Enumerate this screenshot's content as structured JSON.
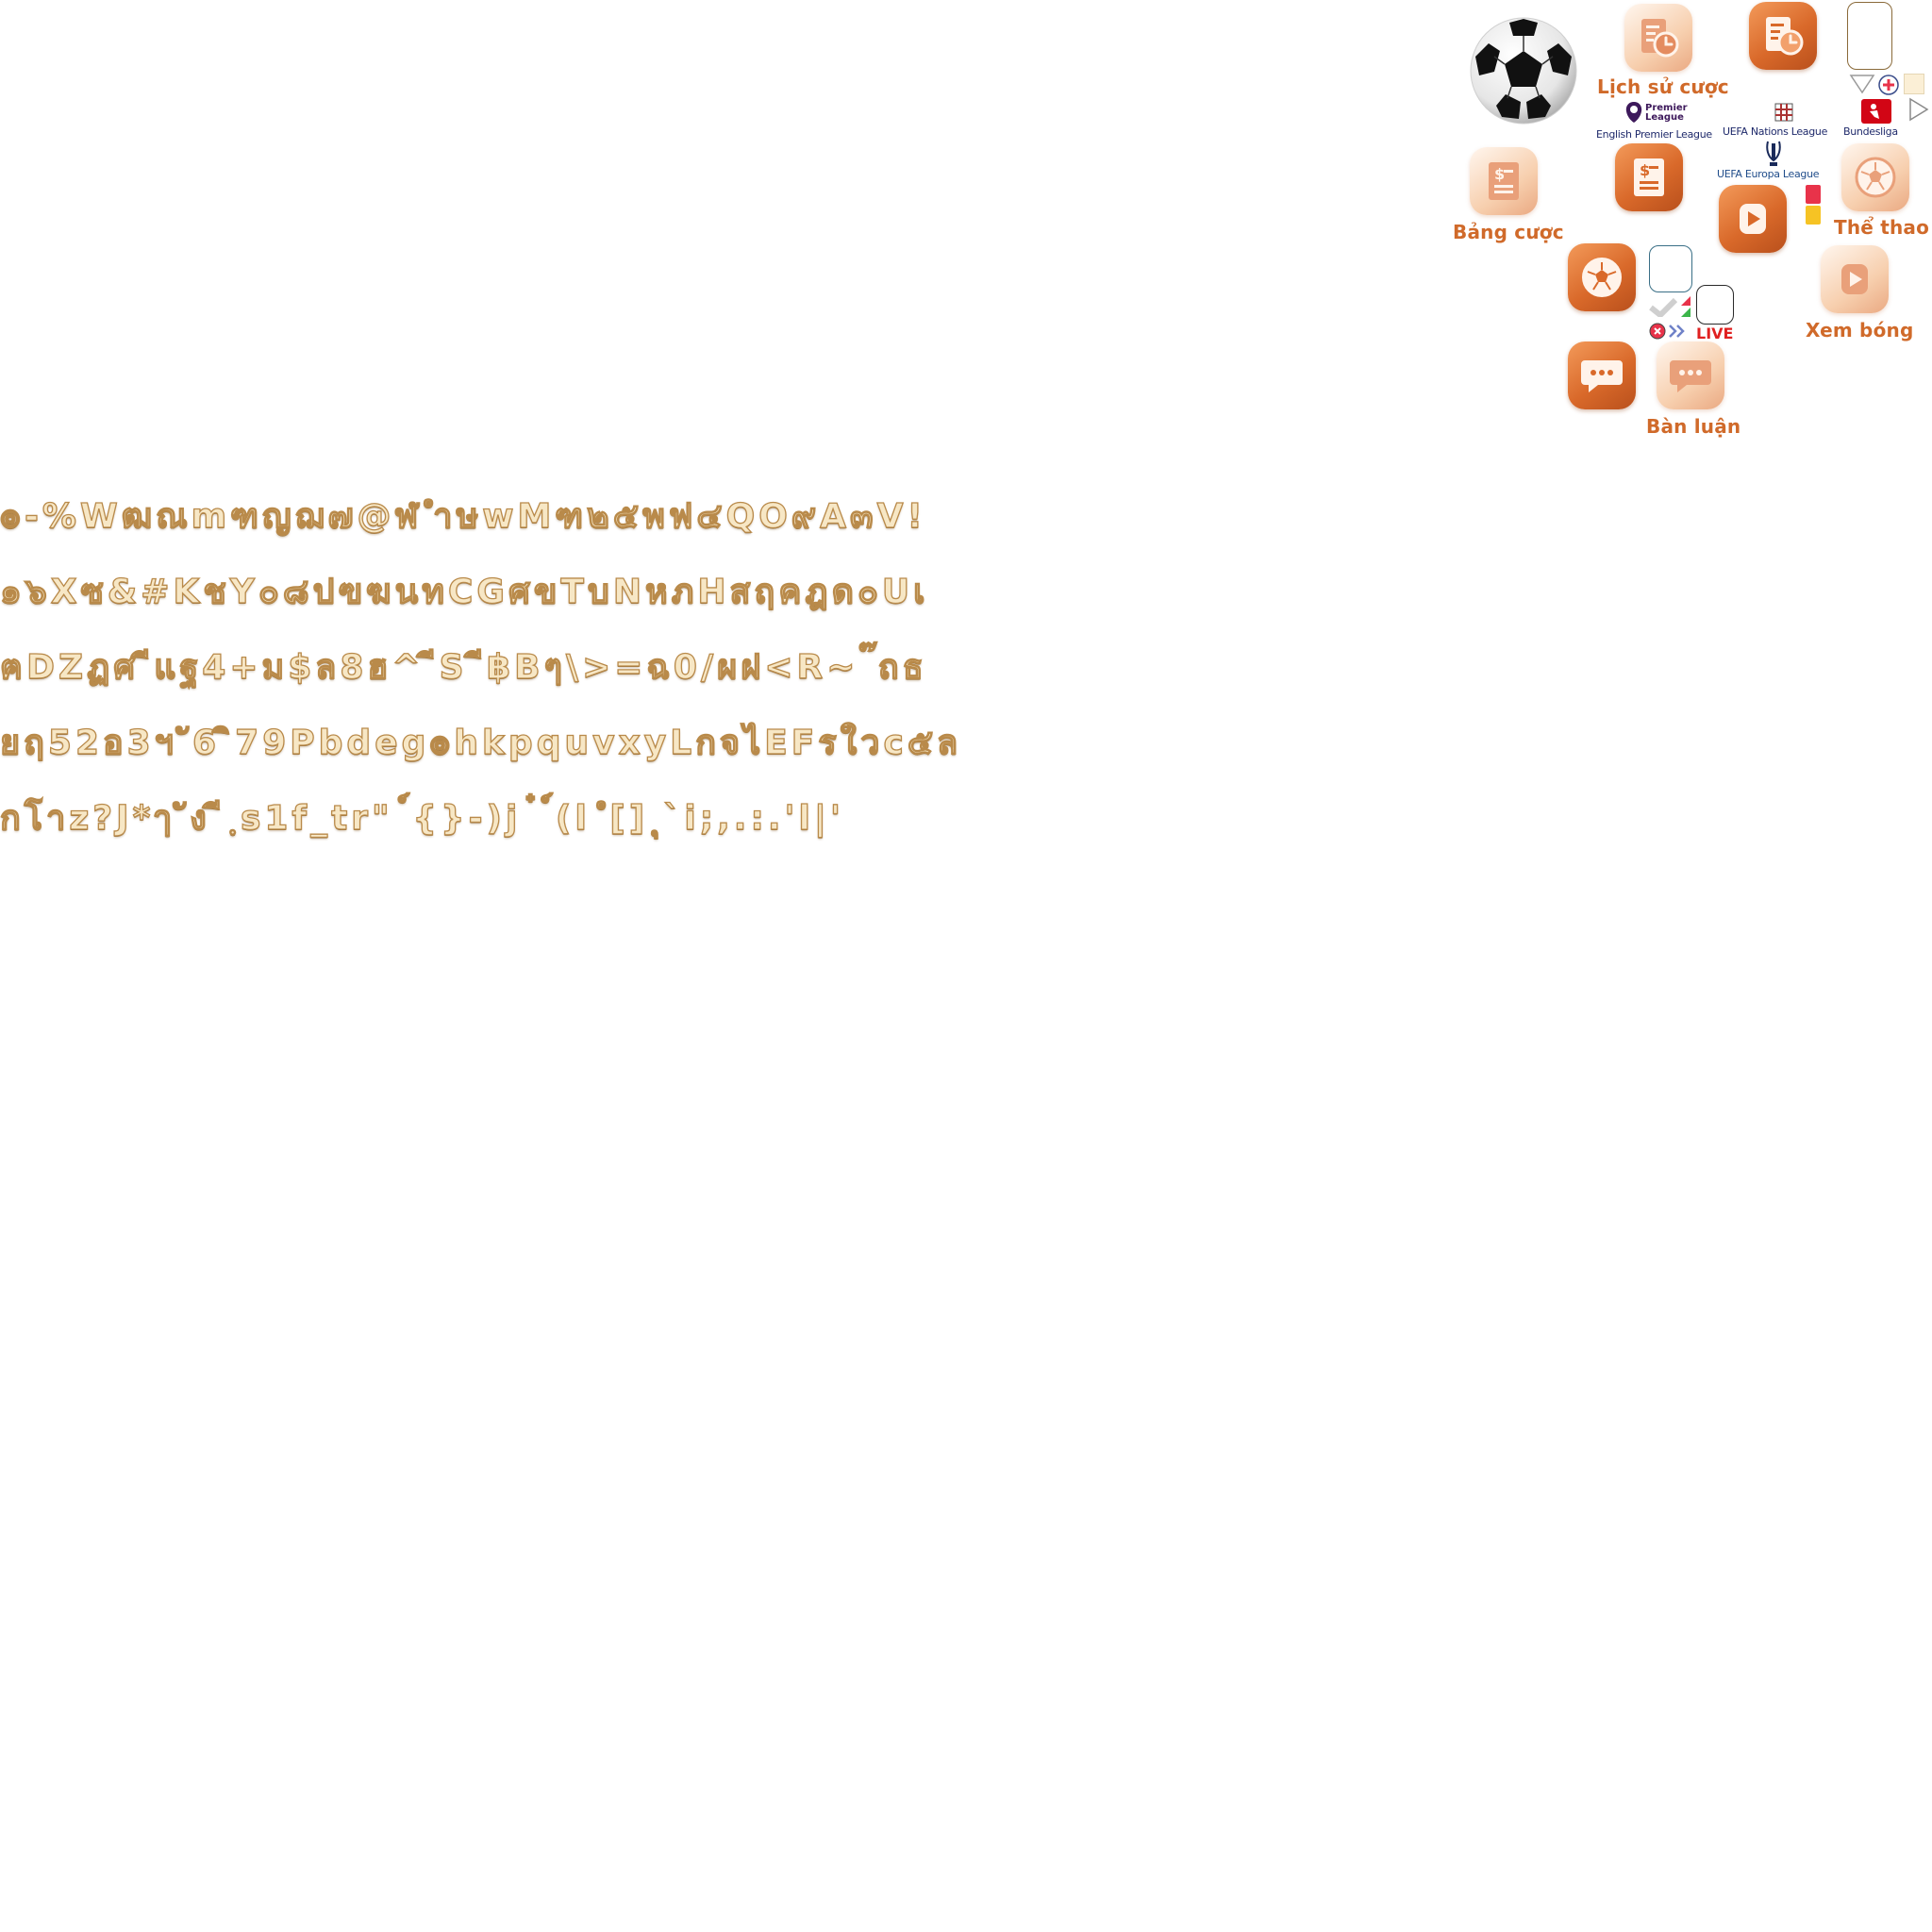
{
  "colors": {
    "accent": "#d06a2a",
    "tile_light": "#f7cfae",
    "tile_dark": "#d9692a",
    "glyph_fill": "#f7e7c5",
    "glyph_outline": "#b98a4a",
    "live_red": "#e02020",
    "card_red": "#e8334a",
    "card_yellow": "#f6c324"
  },
  "labels": {
    "bet_history": "Lịch sử cược",
    "bet_board": "Bảng cược",
    "sports": "Thể thao",
    "watch_football": "Xem bóng",
    "discussion": "Bàn luận",
    "live": "LIVE"
  },
  "leagues": {
    "epl_logo_text": "Premier League",
    "epl": "English Premier League",
    "nations": "UEFA Nations League",
    "bundesliga": "Bundesliga",
    "europa": "UEFA Europa League"
  },
  "icons": [
    "soccer-ball-icon",
    "history-icon",
    "receipt-icon",
    "soccer-icon",
    "play-icon",
    "chat-icon",
    "triangle-icon",
    "plus-circle-icon",
    "play-outline-icon",
    "red-card-icon",
    "yellow-card-icon",
    "close-circle-icon",
    "chevron-double-right-icon"
  ],
  "glyph_rows": [
    "๏-%Wฒณmฑญฌ๗@ฬ ำษwMฑ๒๕พฟ๔QO๙A๓V!",
    "๑๖Xซ&#KชY๐๘ปฃฆนทCGศขTบNหภHสฤคฎด๐Uเ",
    "ฅDZฏศ ีแฐ4+ม$ล8ฮ^ ีS ี฿Bๆ\\>=ฉ0/ผฝ<R~ ๊ถธ",
    "ยฤ52อ3ฯ ั6 ิ79Pbdeg๏hkpquvxyLกจไEFรใวc๕ล",
    "กโาz?J*ๅ ัง ี ฺs1f_tr\" ์{}-)j ๋ ์(l ํ[] ุ`i;,.:.'l|'"
  ]
}
